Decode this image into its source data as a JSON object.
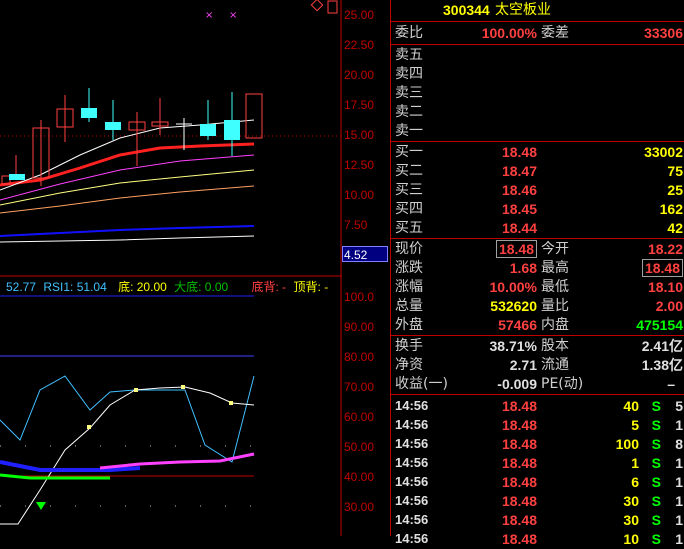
{
  "header": {
    "code": "300344",
    "name": "太空板业"
  },
  "weibi": {
    "label": "委比",
    "value": "100.00%",
    "diff_label": "委差",
    "diff_value": "33306"
  },
  "sell": [
    {
      "label": "卖五",
      "price": "",
      "vol": ""
    },
    {
      "label": "卖四",
      "price": "",
      "vol": ""
    },
    {
      "label": "卖三",
      "price": "",
      "vol": ""
    },
    {
      "label": "卖二",
      "price": "",
      "vol": ""
    },
    {
      "label": "卖一",
      "price": "",
      "vol": ""
    }
  ],
  "buy": [
    {
      "label": "买一",
      "price": "18.48",
      "vol": "33002"
    },
    {
      "label": "买二",
      "price": "18.47",
      "vol": "75"
    },
    {
      "label": "买三",
      "price": "18.46",
      "vol": "25"
    },
    {
      "label": "买四",
      "price": "18.45",
      "vol": "162"
    },
    {
      "label": "买五",
      "price": "18.44",
      "vol": "42"
    }
  ],
  "stats": [
    {
      "l1": "现价",
      "v1": "18.48",
      "l2": "今开",
      "v2": "18.22"
    },
    {
      "l1": "涨跌",
      "v1": "1.68",
      "l2": "最高",
      "v2": "18.48"
    },
    {
      "l1": "涨幅",
      "v1": "10.00%",
      "l2": "最低",
      "v2": "18.10"
    },
    {
      "l1": "总量",
      "v1": "532620",
      "l2": "量比",
      "v2": "2.00"
    },
    {
      "l1": "外盘",
      "v1": "57466",
      "l2": "内盘",
      "v2": "475154"
    }
  ],
  "fund": [
    {
      "l1": "换手",
      "v1": "38.71%",
      "l2": "股本",
      "v2": "2.41亿"
    },
    {
      "l1": "净资",
      "v1": "2.71",
      "l2": "流通",
      "v2": "1.38亿"
    },
    {
      "l1": "收益(一)",
      "v1": "-0.009",
      "l2": "PE(动)",
      "v2": "–"
    }
  ],
  "ticks": [
    {
      "time": "14:56",
      "price": "18.48",
      "vol": "40",
      "side": "S",
      "n": "5"
    },
    {
      "time": "14:56",
      "price": "18.48",
      "vol": "5",
      "side": "S",
      "n": "1"
    },
    {
      "time": "14:56",
      "price": "18.48",
      "vol": "100",
      "side": "S",
      "n": "8"
    },
    {
      "time": "14:56",
      "price": "18.48",
      "vol": "1",
      "side": "S",
      "n": "1"
    },
    {
      "time": "14:56",
      "price": "18.48",
      "vol": "6",
      "side": "S",
      "n": "1"
    },
    {
      "time": "14:56",
      "price": "18.48",
      "vol": "30",
      "side": "S",
      "n": "1"
    },
    {
      "time": "14:56",
      "price": "18.48",
      "vol": "30",
      "side": "S",
      "n": "1"
    },
    {
      "time": "14:56",
      "price": "18.48",
      "vol": "10",
      "side": "S",
      "n": "1"
    }
  ],
  "price_axis": [
    "25.00",
    "22.50",
    "20.00",
    "17.50",
    "15.00",
    "12.50",
    "10.00",
    "7.50"
  ],
  "ind_axis": [
    "100.0",
    "90.00",
    "80.00",
    "70.00",
    "60.00",
    "50.00",
    "40.00",
    "30.00"
  ],
  "cursor_price": "4.52",
  "indicator": {
    "rsi_prev": "52.77",
    "rsi1": "RSI1: 51.04",
    "di": "底: 20.00",
    "dadi": "大底: 0.00",
    "dibei": "底背: -",
    "dingbei": "顶背: -"
  },
  "top_markers": [
    "×",
    "×"
  ],
  "colors": {
    "red": "#ff4040",
    "green": "#00ff00",
    "yellow": "#ffff00",
    "border": "#c00000",
    "cyan": "#00ffff"
  }
}
